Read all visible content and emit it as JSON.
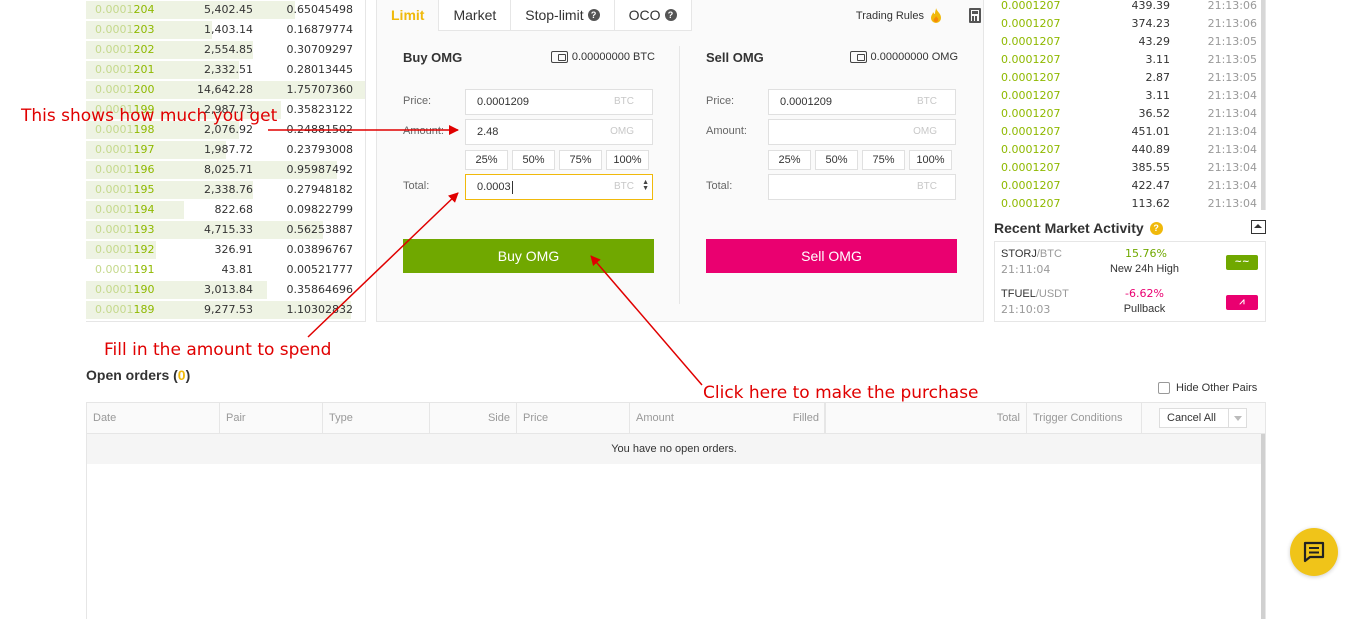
{
  "orderbook": {
    "rows": [
      {
        "price_dim": "0.0001",
        "price_hi": "204",
        "amount": "5,402.45",
        "total": "0.65045498"
      },
      {
        "price_dim": "0.0001",
        "price_hi": "203",
        "amount": "1,403.14",
        "total": "0.16879774"
      },
      {
        "price_dim": "0.0001",
        "price_hi": "202",
        "amount": "2,554.85",
        "total": "0.30709297"
      },
      {
        "price_dim": "0.0001",
        "price_hi": "201",
        "amount": "2,332.51",
        "total": "0.28013445"
      },
      {
        "price_dim": "0.0001",
        "price_hi": "200",
        "amount": "14,642.28",
        "total": "1.75707360"
      },
      {
        "price_dim": "0.0001",
        "price_hi": "199",
        "amount": "2,987.73",
        "total": "0.35823122"
      },
      {
        "price_dim": "0.0001",
        "price_hi": "198",
        "amount": "2,076.92",
        "total": "0.24881502"
      },
      {
        "price_dim": "0.0001",
        "price_hi": "197",
        "amount": "1,987.72",
        "total": "0.23793008"
      },
      {
        "price_dim": "0.0001",
        "price_hi": "196",
        "amount": "8,025.71",
        "total": "0.95987492"
      },
      {
        "price_dim": "0.0001",
        "price_hi": "195",
        "amount": "2,338.76",
        "total": "0.27948182"
      },
      {
        "price_dim": "0.0001",
        "price_hi": "194",
        "amount": "822.68",
        "total": "0.09822799"
      },
      {
        "price_dim": "0.0001",
        "price_hi": "193",
        "amount": "4,715.33",
        "total": "0.56253887"
      },
      {
        "price_dim": "0.0001",
        "price_hi": "192",
        "amount": "326.91",
        "total": "0.03896767"
      },
      {
        "price_dim": "0.0001",
        "price_hi": "191",
        "amount": "43.81",
        "total": "0.00521777"
      },
      {
        "price_dim": "0.0001",
        "price_hi": "190",
        "amount": "3,013.84",
        "total": "0.35864696"
      },
      {
        "price_dim": "0.0001",
        "price_hi": "189",
        "amount": "9,277.53",
        "total": "1.10302832"
      }
    ]
  },
  "trade": {
    "tabs": [
      {
        "label": "Limit"
      },
      {
        "label": "Market"
      },
      {
        "label": "Stop-limit"
      },
      {
        "label": "OCO"
      }
    ],
    "trading_rules": "Trading Rules",
    "buy": {
      "title": "Buy OMG",
      "balance": "0.00000000 BTC",
      "price_label": "Price:",
      "price_value": "0.0001209",
      "price_unit": "BTC",
      "amount_label": "Amount:",
      "amount_value": "2.48",
      "amount_unit": "OMG",
      "total_label": "Total:",
      "total_value": "0.0003",
      "total_unit": "BTC",
      "button": "Buy OMG"
    },
    "sell": {
      "title": "Sell OMG",
      "balance": "0.00000000 OMG",
      "price_label": "Price:",
      "price_value": "0.0001209",
      "price_unit": "BTC",
      "amount_label": "Amount:",
      "amount_value": "",
      "amount_unit": "OMG",
      "total_label": "Total:",
      "total_value": "",
      "total_unit": "BTC",
      "button": "Sell OMG"
    },
    "percent_buttons": [
      "25%",
      "50%",
      "75%",
      "100%"
    ]
  },
  "trades": {
    "rows": [
      {
        "price": "0.0001207",
        "amount": "439.39",
        "time": "21:13:06"
      },
      {
        "price": "0.0001207",
        "amount": "374.23",
        "time": "21:13:06"
      },
      {
        "price": "0.0001207",
        "amount": "43.29",
        "time": "21:13:05"
      },
      {
        "price": "0.0001207",
        "amount": "3.11",
        "time": "21:13:05"
      },
      {
        "price": "0.0001207",
        "amount": "2.87",
        "time": "21:13:05"
      },
      {
        "price": "0.0001207",
        "amount": "3.11",
        "time": "21:13:04"
      },
      {
        "price": "0.0001207",
        "amount": "36.52",
        "time": "21:13:04"
      },
      {
        "price": "0.0001207",
        "amount": "451.01",
        "time": "21:13:04"
      },
      {
        "price": "0.0001207",
        "amount": "440.89",
        "time": "21:13:04"
      },
      {
        "price": "0.0001207",
        "amount": "385.55",
        "time": "21:13:04"
      },
      {
        "price": "0.0001207",
        "amount": "422.47",
        "time": "21:13:04"
      },
      {
        "price": "0.0001207",
        "amount": "113.62",
        "time": "21:13:04"
      }
    ]
  },
  "market_activity": {
    "title": "Recent Market Activity",
    "items": [
      {
        "base": "STORJ",
        "quote": "/BTC",
        "time": "21:11:04",
        "pct": "15.76%",
        "desc": "New 24h High",
        "color": "#70a800"
      },
      {
        "base": "TFUEL",
        "quote": "/USDT",
        "time": "21:10:03",
        "pct": "-6.62%",
        "desc": "Pullback",
        "color": "#ea0070"
      }
    ]
  },
  "open_orders": {
    "title": "Open orders (",
    "count": "0",
    "close": ")",
    "hide_other_pairs": "Hide Other Pairs",
    "columns": [
      "Date",
      "Pair",
      "Type",
      "Side",
      "Price",
      "Amount",
      "Filled",
      "Total",
      "Trigger Conditions"
    ],
    "cancel_all": "Cancel All",
    "empty": "You have no open orders."
  },
  "annotations": {
    "amount_note": "This shows how much you get",
    "total_note": "Fill in the amount to spend",
    "button_note": "Click here to make the purchase"
  },
  "colors": {
    "accent": "#f0b90b",
    "buy": "#70a800",
    "sell": "#ea0070",
    "annotation": "#e00000"
  }
}
